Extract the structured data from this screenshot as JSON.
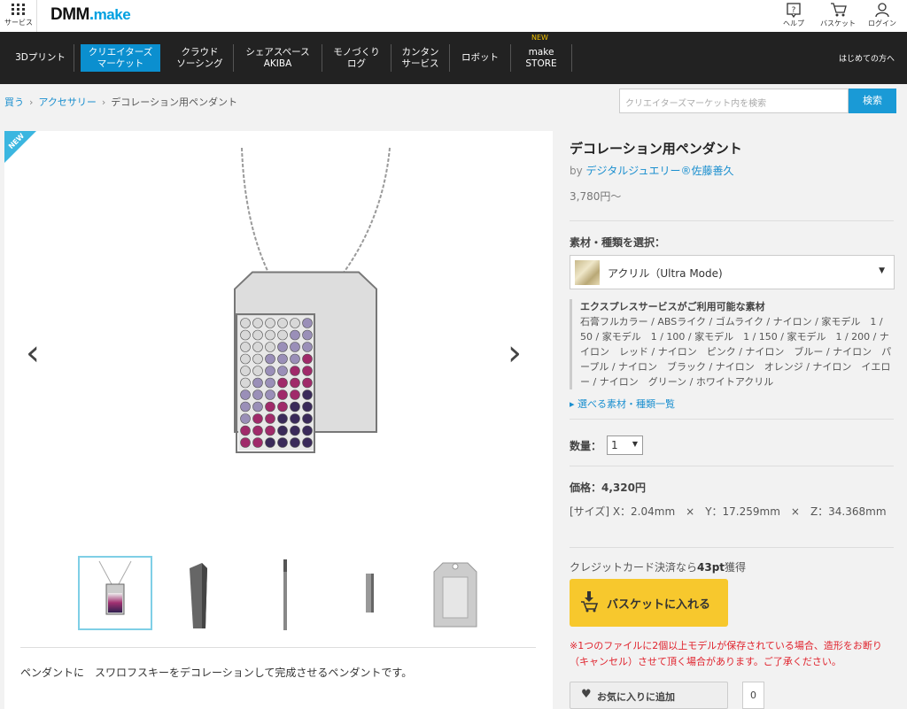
{
  "header": {
    "service_label": "サービス",
    "logo_text": "DMM",
    "logo_dot": ".",
    "logo_make": "make",
    "help_label": "ヘルプ",
    "basket_label": "バスケット",
    "login_label": "ログイン"
  },
  "nav": {
    "items": [
      {
        "label": "3Dプリント"
      },
      {
        "label": "クリエイターズ\nマーケット"
      },
      {
        "label": "クラウド\nソーシング"
      },
      {
        "label": "シェアスペース\nAKIBA"
      },
      {
        "label": "モノづくり\nログ"
      },
      {
        "label": "カンタン\nサービス"
      },
      {
        "label": "ロボット"
      },
      {
        "label": "make\nSTORE"
      }
    ],
    "new_badge": "NEW",
    "first_time": "はじめての方へ"
  },
  "breadcrumb": {
    "items": [
      "買う",
      "アクセサリー",
      "デコレーション用ペンダント"
    ]
  },
  "search": {
    "placeholder": "クリエイターズマーケット内を検索",
    "button": "検索"
  },
  "gallery": {
    "new_label": "NEW",
    "prev": "‹",
    "next": "›",
    "description": "ペンダントに　スワロフスキーをデコレーションして完成させるペンダントです。"
  },
  "product": {
    "title": "デコレーション用ペンダント",
    "by_prefix": "by ",
    "creator": "デジタルジュエリー®佐藤善久",
    "price_from": "3,780円～",
    "material_label": "素材・種類を選択：",
    "material_selected": "アクリル（Ultra Mode)",
    "express_title": "エクスプレスサービスがご利用可能な素材",
    "express_list": "石膏フルカラー / ABSライク / ゴムライク / ナイロン / 家モデル　1 / 50 / 家モデル　1 / 100 / 家モデル　1 / 150 / 家モデル　1 / 200 / ナイロン　レッド / ナイロン　ピンク / ナイロン　ブルー / ナイロン　パープル / ナイロン　ブラック / ナイロン　オレンジ / ナイロン　イエロー / ナイロン　グリーン / ホワイトアクリル",
    "material_list_link": "選べる素材・種類一覧",
    "qty_label": "数量：",
    "qty_value": "1",
    "price": "価格：4,320円",
    "size": "[サイズ] X：2.04mm　×　Y：17.259mm　×　Z：34.368mm",
    "credit_prefix": "クレジットカード決済なら",
    "credit_points": "43pt",
    "credit_suffix": "獲得",
    "cart_button": "バスケットに入れる",
    "warning": "※1つのファイルに2個以上モデルが保存されている場合、造形をお断り（キャンセル）させて頂く場合があります。ご了承ください。",
    "favorite_button": "お気に入りに追加",
    "favorite_count": "0"
  },
  "colors": {
    "accent_blue": "#1a9ad6",
    "nav_bg": "#222222",
    "cart_yellow": "#f7c82d",
    "warning_red": "#e0232d"
  }
}
